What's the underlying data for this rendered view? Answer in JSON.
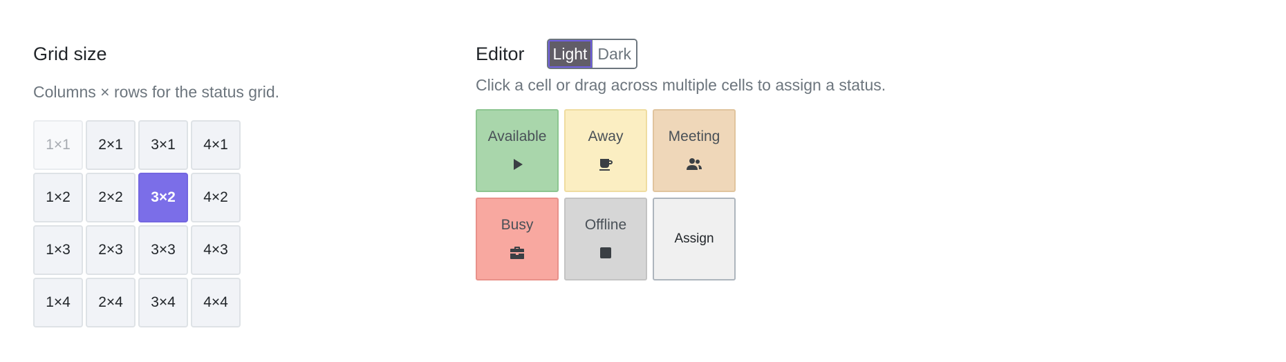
{
  "grid_size": {
    "title": "Grid size",
    "subtitle": "Columns × rows for the status grid.",
    "cells": [
      {
        "label": "1×1",
        "state": "disabled"
      },
      {
        "label": "2×1",
        "state": "normal"
      },
      {
        "label": "3×1",
        "state": "normal"
      },
      {
        "label": "4×1",
        "state": "normal"
      },
      {
        "label": "1×2",
        "state": "normal"
      },
      {
        "label": "2×2",
        "state": "normal"
      },
      {
        "label": "3×2",
        "state": "selected"
      },
      {
        "label": "4×2",
        "state": "normal"
      },
      {
        "label": "1×3",
        "state": "normal"
      },
      {
        "label": "2×3",
        "state": "normal"
      },
      {
        "label": "3×3",
        "state": "normal"
      },
      {
        "label": "4×3",
        "state": "normal"
      },
      {
        "label": "1×4",
        "state": "normal"
      },
      {
        "label": "2×4",
        "state": "normal"
      },
      {
        "label": "3×4",
        "state": "normal"
      },
      {
        "label": "4×4",
        "state": "normal"
      }
    ],
    "selected": "3×2"
  },
  "editor": {
    "title": "Editor",
    "theme_toggle": {
      "options": [
        "Light",
        "Dark"
      ],
      "active": "Light"
    },
    "hint": "Click a cell or drag across multiple cells to assign a status.",
    "statuses": [
      {
        "label": "Available",
        "icon": "play-icon",
        "bg": "#a9d6ab",
        "border": "#8cc590"
      },
      {
        "label": "Away",
        "icon": "coffee-icon",
        "bg": "#fbeec2",
        "border": "#efdca0"
      },
      {
        "label": "Meeting",
        "icon": "users-icon",
        "bg": "#efd7b9",
        "border": "#e0c49d"
      },
      {
        "label": "Busy",
        "icon": "briefcase-icon",
        "bg": "#f8a8a0",
        "border": "#e8918a"
      },
      {
        "label": "Offline",
        "icon": "stop-icon",
        "bg": "#d6d6d6",
        "border": "#c3c3c3"
      },
      {
        "label": "Assign",
        "icon": "",
        "bg": "#f0f0f0",
        "border": "#adb5bd"
      }
    ]
  },
  "colors": {
    "accent": "#7b6ee8",
    "muted_text": "#6c757d"
  }
}
